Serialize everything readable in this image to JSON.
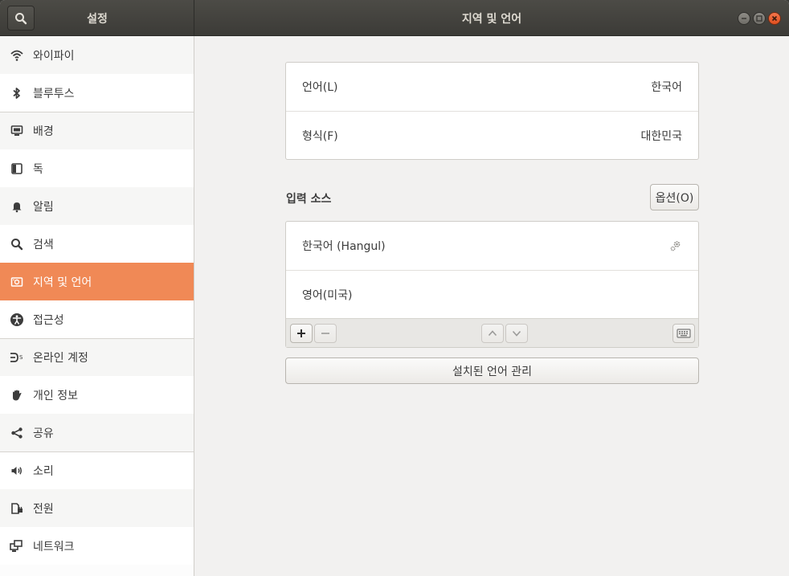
{
  "header": {
    "sidebar_title": "설정",
    "main_title": "지역 및 언어"
  },
  "sidebar": {
    "items": [
      {
        "label": "와이파이",
        "icon": "wifi-icon"
      },
      {
        "label": "블루투스",
        "icon": "bluetooth-icon"
      },
      {
        "label": "배경",
        "icon": "background-icon"
      },
      {
        "label": "독",
        "icon": "dock-icon"
      },
      {
        "label": "알림",
        "icon": "bell-icon"
      },
      {
        "label": "검색",
        "icon": "search-icon"
      },
      {
        "label": "지역 및 언어",
        "icon": "region-icon",
        "active": true
      },
      {
        "label": "접근성",
        "icon": "accessibility-icon"
      },
      {
        "label": "온라인 계정",
        "icon": "online-accounts-icon"
      },
      {
        "label": "개인 정보",
        "icon": "privacy-hand-icon"
      },
      {
        "label": "공유",
        "icon": "share-icon"
      },
      {
        "label": "소리",
        "icon": "speaker-icon"
      },
      {
        "label": "전원",
        "icon": "power-icon"
      },
      {
        "label": "네트워크",
        "icon": "network-icon"
      }
    ]
  },
  "language": {
    "label": "언어(L)",
    "value": "한국어"
  },
  "formats": {
    "label": "형식(F)",
    "value": "대한민국"
  },
  "input_sources": {
    "title": "입력 소스",
    "options_label": "옵션(O)",
    "items": [
      {
        "label": "한국어 (Hangul)",
        "has_settings": true
      },
      {
        "label": "영어(미국)",
        "has_settings": false
      }
    ]
  },
  "manage_label": "설치된 언어 관리",
  "colors": {
    "accent": "#f08956",
    "headerbar": "#3c3b37"
  }
}
